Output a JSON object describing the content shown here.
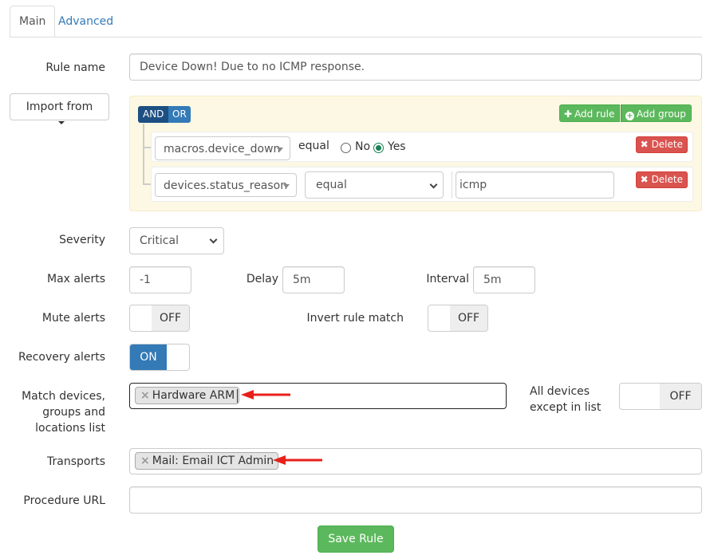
{
  "tabs": [
    {
      "label": "Main"
    },
    {
      "label": "Advanced"
    }
  ],
  "form": {
    "rule_name_label": "Rule name",
    "rule_name_value": "Device Down! Due to no ICMP response.",
    "import_label": "Import from",
    "severity_label": "Severity",
    "severity_value": "Critical",
    "max_alerts_label": "Max alerts",
    "max_alerts_value": "-1",
    "delay_label": "Delay",
    "delay_value": "5m",
    "interval_label": "Interval",
    "interval_value": "5m",
    "mute_label": "Mute alerts",
    "mute_state": "OFF",
    "invert_label": "Invert rule match",
    "invert_state": "OFF",
    "recovery_label": "Recovery alerts",
    "recovery_state": "ON",
    "match_label_1": "Match devices,",
    "match_label_2": "groups and",
    "match_label_3": "locations list",
    "match_tag": "Hardware ARM",
    "all_devices_label_1": "All devices",
    "all_devices_label_2": "except in list",
    "all_devices_state": "OFF",
    "transports_label": "Transports",
    "transports_tag": "Mail: Email ICT Admin",
    "procedure_label": "Procedure URL",
    "procedure_value": "",
    "save_label": "Save Rule",
    "tag_remove": "×"
  },
  "query_builder": {
    "and_label": "AND",
    "or_label": "OR",
    "add_rule_label": "Add rule",
    "add_group_label": "Add group",
    "rules": [
      {
        "field": "macros.device_down",
        "operator": "equal",
        "radio_no": "No",
        "radio_yes": "Yes",
        "selected": "Yes",
        "delete_label": "Delete"
      },
      {
        "field": "devices.status_reason",
        "operator": "equal",
        "value": "icmp",
        "delete_label": "Delete"
      }
    ]
  },
  "colors": {
    "primary": "#337ab7",
    "success": "#5cb85c",
    "danger": "#d9534f",
    "annotation_arrow": "#e8201a"
  }
}
